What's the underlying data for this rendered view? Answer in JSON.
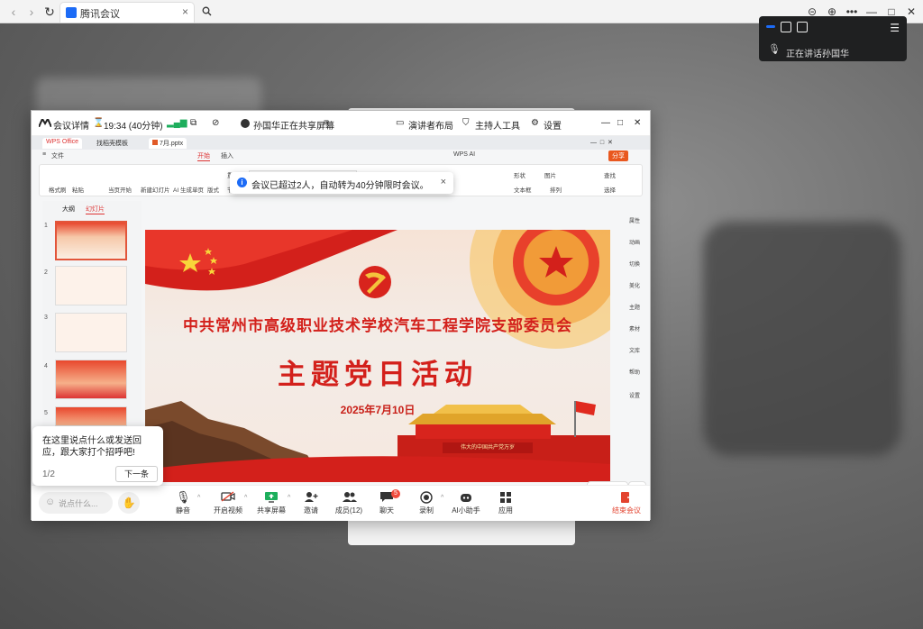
{
  "browser": {
    "tab_title": "腾讯会议",
    "tab_close": "×"
  },
  "speaker_widget": {
    "label": "正在讲话:",
    "name": "孙国华"
  },
  "meeting_top": {
    "details": "会议详情",
    "time": "19:34 (40分钟)",
    "sharing": "孙国华正在共享屏幕",
    "presenter_layout": "演讲者布局",
    "host_tools": "主持人工具",
    "settings": "设置"
  },
  "wps": {
    "tabs": [
      "WPS Office",
      "找稻壳模板",
      "7月.pptx"
    ],
    "menu": [
      "文件",
      "开始",
      "插入",
      "WPS AI"
    ],
    "ribbon": {
      "format_painter": "格式刷",
      "paste": "粘贴",
      "start_from_current": "当页开始",
      "new_slide": "新建幻灯片",
      "ai_generate": "AI 生成单页",
      "layout": "版式",
      "section": "节",
      "reset": "重置",
      "shape": "形状",
      "picture": "图片",
      "textbox": "文本框",
      "arrange": "排列",
      "find_replace": "查找",
      "select": "选择",
      "share": "分享"
    },
    "panel_tabs": [
      "大纲",
      "幻灯片"
    ],
    "slide_numbers": [
      "1",
      "2",
      "3",
      "4",
      "5"
    ],
    "right_rail": [
      "属性",
      "动画",
      "切换",
      "美化",
      "主题",
      "素材",
      "文库",
      "帮助",
      "设置"
    ]
  },
  "slide": {
    "org_title": "中共常州市高级职业技术学校汽车工程学院支部委员会",
    "main_title": "主题党日活动",
    "date": "2025年7月10日",
    "banner": "伟大的中国共产党万岁"
  },
  "notice": {
    "text": "会议已超过2人，自动转为40分钟限时会议。",
    "close": "×"
  },
  "tip": {
    "text": "在这里说点什么或发送回应，跟大家打个招呼吧!",
    "page": "1/2",
    "next": "下一条"
  },
  "annotate": "批注",
  "bottom_bar": {
    "chat_placeholder": "说点什么...",
    "mute": "静音",
    "video": "开启视频",
    "share": "共享屏幕",
    "invite": "邀请",
    "members": "成员(12)",
    "chat": "聊天",
    "chat_badge": "5",
    "record": "录制",
    "ai_assistant": "AI小助手",
    "apps": "应用",
    "end": "结束会议"
  },
  "colors": {
    "accent_blue": "#1c6bf6",
    "end_red": "#e3432f",
    "party_red": "#d3201b"
  }
}
